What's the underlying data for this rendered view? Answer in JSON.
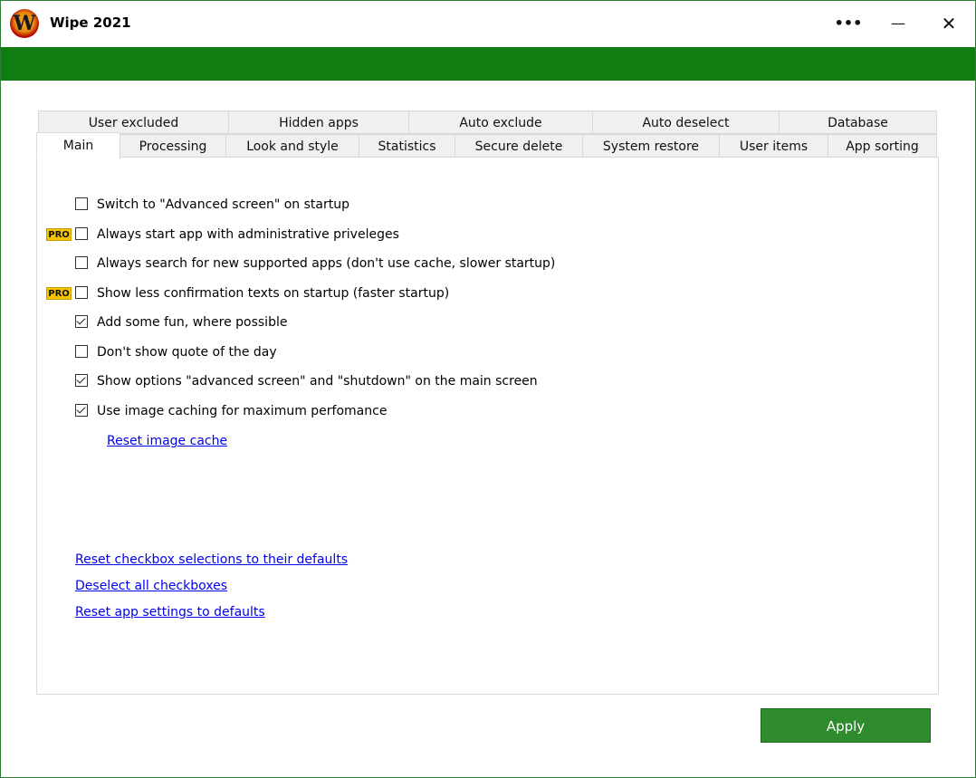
{
  "window": {
    "title": "Wipe 2021",
    "logo_letter": "W",
    "more_label": "•••",
    "minimize_label": "—",
    "close_label": "✕"
  },
  "tabs_back": [
    "User excluded",
    "Hidden apps",
    "Auto exclude",
    "Auto deselect",
    "Database"
  ],
  "tabs_front": [
    "Main",
    "Processing",
    "Look and style",
    "Statistics",
    "Secure delete",
    "System restore",
    "User items",
    "App sorting"
  ],
  "active_tab": "Main",
  "pro_badge": "PRO",
  "options": [
    {
      "label": "Switch to \"Advanced screen\" on startup",
      "checked": false,
      "pro": false
    },
    {
      "label": "Always start app with administrative priveleges",
      "checked": false,
      "pro": true
    },
    {
      "label": "Always search for new supported apps (don't use cache, slower startup)",
      "checked": false,
      "pro": false
    },
    {
      "label": "Show less confirmation texts on startup (faster startup)",
      "checked": false,
      "pro": true
    },
    {
      "label": "Add some fun, where possible",
      "checked": true,
      "pro": false
    },
    {
      "label": "Don't show quote of the day",
      "checked": false,
      "pro": false
    },
    {
      "label": "Show options \"advanced screen\" and \"shutdown\" on the main screen",
      "checked": true,
      "pro": false
    },
    {
      "label": "Use image caching for maximum perfomance",
      "checked": true,
      "pro": false
    }
  ],
  "links": {
    "reset_image_cache": "Reset image cache",
    "reset_checkbox": "Reset checkbox selections to their defaults",
    "deselect_all": "Deselect all checkboxes",
    "reset_settings": "Reset app settings to defaults"
  },
  "apply_label": "Apply",
  "colors": {
    "green_bar": "#0f7d11",
    "apply_bg": "#2e8b2e",
    "link": "#0000ee",
    "pro_badge": "#f5c400"
  }
}
